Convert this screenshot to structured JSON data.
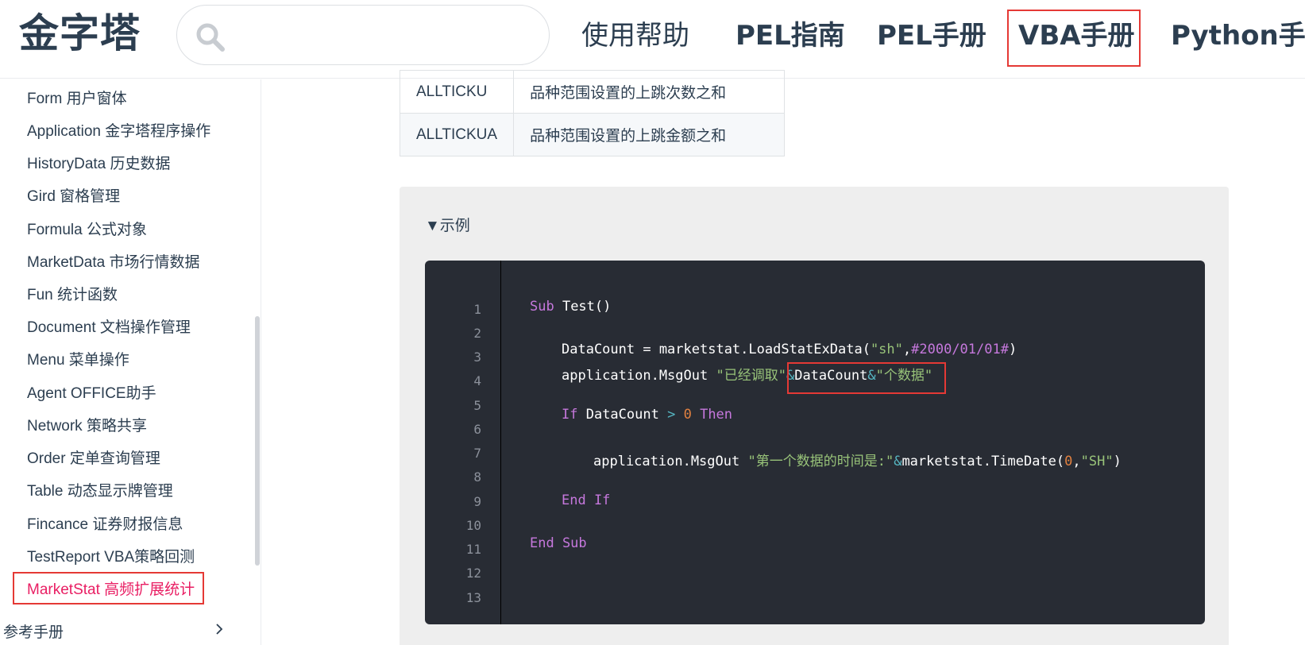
{
  "header": {
    "logo": "金字塔",
    "search": {
      "value": "",
      "placeholder": ""
    },
    "nav": [
      "使用帮助",
      "PEL指南",
      "PEL手册",
      "VBA手册",
      "Python手册"
    ],
    "active_nav": "VBA手册"
  },
  "sidebar": {
    "items": [
      "Form 用户窗体",
      "Application 金字塔程序操作",
      "HistoryData 历史数据",
      "Gird 窗格管理",
      "Formula 公式对象",
      "MarketData 市场行情数据",
      "Fun 统计函数",
      "Document 文档操作管理",
      "Menu 菜单操作",
      "Agent OFFICE助手",
      "Network 策略共享",
      "Order 定单查询管理",
      "Table 动态显示牌管理",
      "Fincance 证券财报信息",
      "TestReport VBA策略回测",
      "MarketStat 高频扩展统计"
    ],
    "active_item": "MarketStat 高频扩展统计",
    "group": "参考手册"
  },
  "table": {
    "rows": [
      {
        "name": "ALLTICKU",
        "desc": "品种范围设置的上跳次数之和"
      },
      {
        "name": "ALLTICKUA",
        "desc": "品种范围设置的上跳金额之和"
      }
    ]
  },
  "example": {
    "summary": "▼示例",
    "line_numbers": [
      "1",
      "2",
      "3",
      "4",
      "5",
      "6",
      "7",
      "8",
      "9",
      "10",
      "11",
      "12",
      "13"
    ],
    "code": {
      "l1_kw": "Sub",
      "l1_rest": " Test()",
      "l3_a": "DataCount = marketstat.LoadStatExData(",
      "l3_s1": "\"sh\"",
      "l3_b": ",",
      "l3_s2": "#2000/01/01#",
      "l3_c": ")",
      "l4_a": "application.MsgOut ",
      "l4_s1": "\"已经调取\"",
      "l4_op1": "&",
      "l4_b": "DataCount",
      "l4_op2": "&",
      "l4_s2": "\"个数据\"",
      "l6_kw1": "If",
      "l6_a": " DataCount ",
      "l6_op": ">",
      "l6_b": " ",
      "l6_num": "0",
      "l6_c": " ",
      "l6_kw2": "Then",
      "l8_a": "application.MsgOut ",
      "l8_s1": "\"第一个数据的时间是:\"",
      "l8_op": "&",
      "l8_b": "marketstat.TimeDate(",
      "l8_num": "0",
      "l8_c": ",",
      "l8_s2": "\"SH\"",
      "l8_d": ")",
      "l10": "End If",
      "l12": "End Sub"
    }
  },
  "colors": {
    "accent": "#e91e63",
    "highlight_border": "#e53935",
    "code_bg": "#282c34",
    "keyword": "#c678dd",
    "string": "#98c379",
    "number": "#e08040",
    "operator": "#56b6c2"
  },
  "icons": {
    "search": "search-icon",
    "chevron": "chevron-right-icon"
  }
}
